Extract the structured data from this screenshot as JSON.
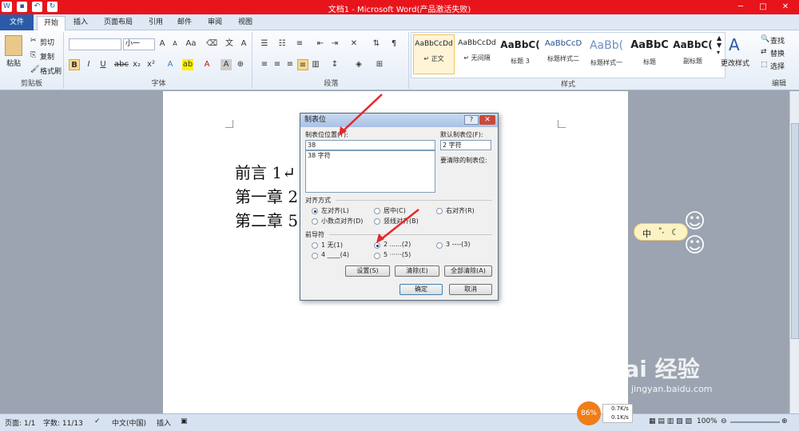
{
  "titlebar": {
    "title": "文档1 - Microsoft Word(产品激活失败)",
    "close": "✕",
    "min": "─",
    "max": "□"
  },
  "tabs": [
    "文件",
    "开始",
    "插入",
    "页面布局",
    "引用",
    "邮件",
    "审阅",
    "视图"
  ],
  "clipboard": {
    "paste": "粘贴",
    "cut": "剪切",
    "copy": "复制",
    "format_painter": "格式刷",
    "label": "剪贴板"
  },
  "font": {
    "name": "",
    "size": "小一",
    "label": "字体",
    "bold": "B",
    "italic": "I",
    "underline": "U",
    "strike": "abc",
    "sub": "x₂",
    "sup": "x²"
  },
  "paragraph": {
    "label": "段落"
  },
  "styles": {
    "items": [
      {
        "preview": "AaBbCcDd",
        "name": "↵ 正文"
      },
      {
        "preview": "AaBbCcDd",
        "name": "↵ 无间隔"
      },
      {
        "preview": "AaBbC(",
        "name": "标题 3"
      },
      {
        "preview": "AaBbCcD",
        "name": "标题样式二"
      },
      {
        "preview": "AaBb(",
        "name": "标题样式一"
      },
      {
        "preview": "AaBbC",
        "name": "标题"
      },
      {
        "preview": "AaBbC(",
        "name": "副标题"
      }
    ],
    "change": "更改样式",
    "label": "样式"
  },
  "editing": {
    "find": "查找",
    "replace": "替换",
    "select": "选择",
    "label": "编辑"
  },
  "document": {
    "lines": [
      "前言 1↵",
      "第一章 2",
      "第二章 5"
    ]
  },
  "dialog": {
    "title": "制表位",
    "help": "?",
    "close": "✕",
    "pos_label": "制表位位置(T):",
    "pos_value": "38",
    "list_item": "38 字符",
    "default_label": "默认制表位(F):",
    "default_value": "2 字符",
    "clear_label": "要清除的制表位:",
    "align_label": "对齐方式",
    "align_left": "左对齐(L)",
    "align_center": "居中(C)",
    "align_right": "右对齐(R)",
    "align_decimal": "小数点对齐(D)",
    "align_bar": "竖线对齐(B)",
    "leader_label": "前导符",
    "leader_1": "1 无(1)",
    "leader_2": "2 ......(2)",
    "leader_3": "3 ----(3)",
    "leader_4": "4 ____(4)",
    "leader_5": "5 ······(5)",
    "btn_set": "设置(S)",
    "btn_clear": "清除(E)",
    "btn_clear_all": "全部清除(A)",
    "btn_ok": "确定",
    "btn_cancel": "取消"
  },
  "ime": {
    "label": "中"
  },
  "statusbar": {
    "page": "页面: 1/1",
    "words": "字数: 11/13",
    "lang": "中文(中国)",
    "mode": "插入",
    "zoom": "100%"
  },
  "net": {
    "percent": "86%",
    "up": "0.7K/s",
    "down": "0.1K/s"
  },
  "watermark": {
    "main": "Bai 经验",
    "sub": "jingyan.baidu.com"
  }
}
